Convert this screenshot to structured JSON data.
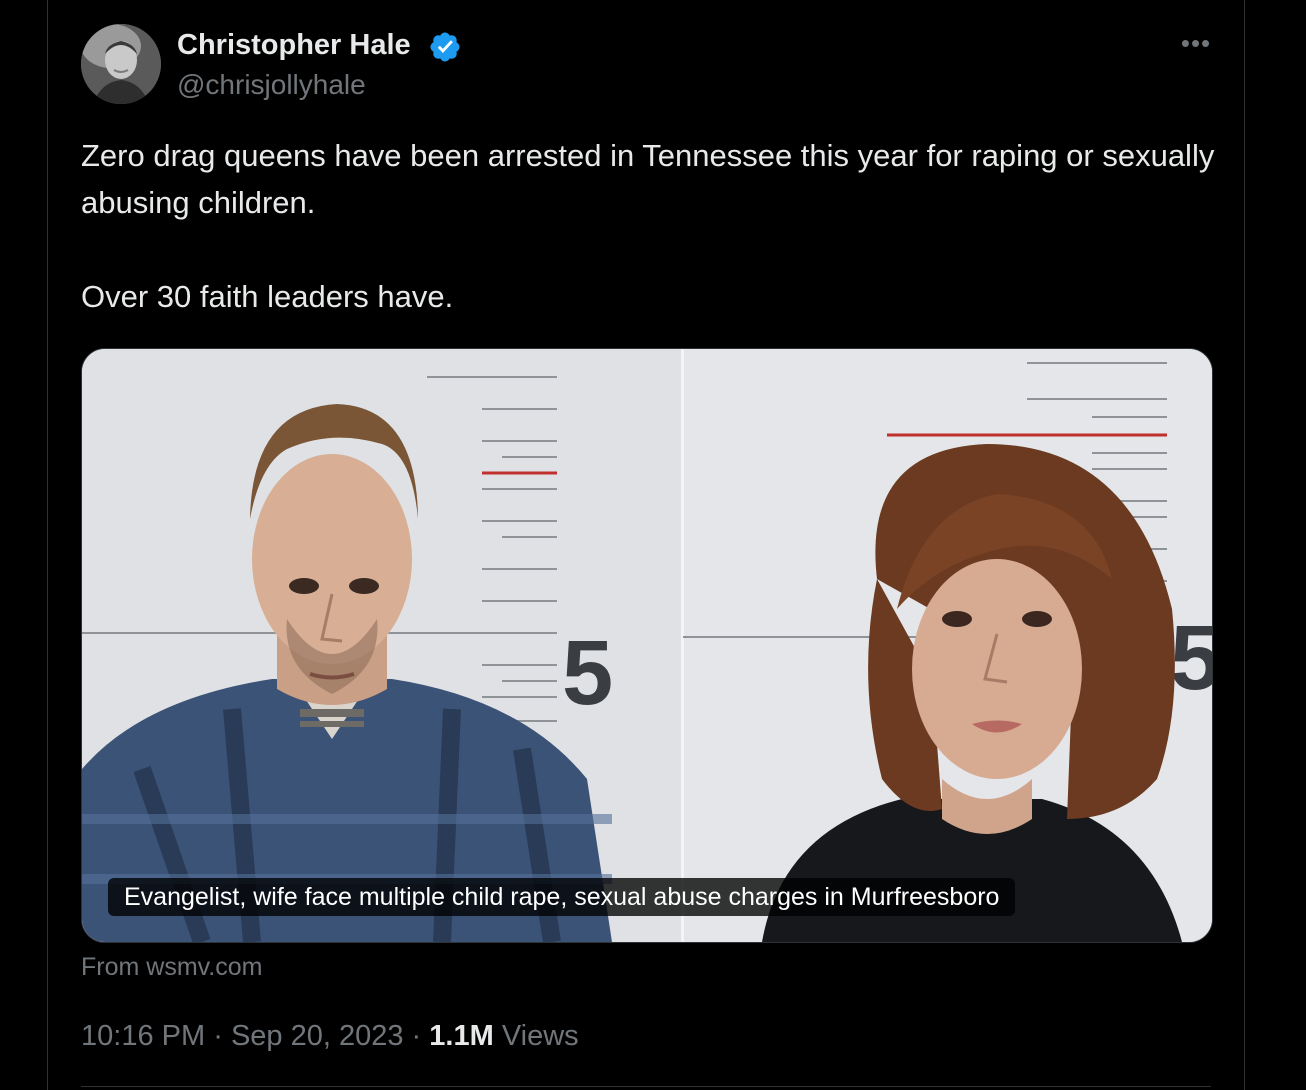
{
  "author": {
    "name": "Christopher Hale",
    "handle": "@chrisjollyhale",
    "verified": true,
    "verified_color": "#1d9bf0"
  },
  "more_icon": "more-horizontal-icon",
  "tweet": {
    "line1": "Zero drag queens have been arrested in Tennessee this year for raping or sexually abusing children.",
    "line2": "Over 30 faith leaders have."
  },
  "media": {
    "caption": "Evangelist, wife face multiple child rape, sexual abuse charges in Murfreesboro",
    "height_marker_left": "5",
    "height_marker_right": "5"
  },
  "source": "From wsmv.com",
  "meta": {
    "time": "10:16 PM",
    "separator": "·",
    "date": "Sep 20, 2023",
    "views_count": "1.1M",
    "views_label": "Views"
  },
  "colors": {
    "background": "#000000",
    "text_primary": "#e7e9ea",
    "text_secondary": "#71767b",
    "border": "#2f3336"
  }
}
